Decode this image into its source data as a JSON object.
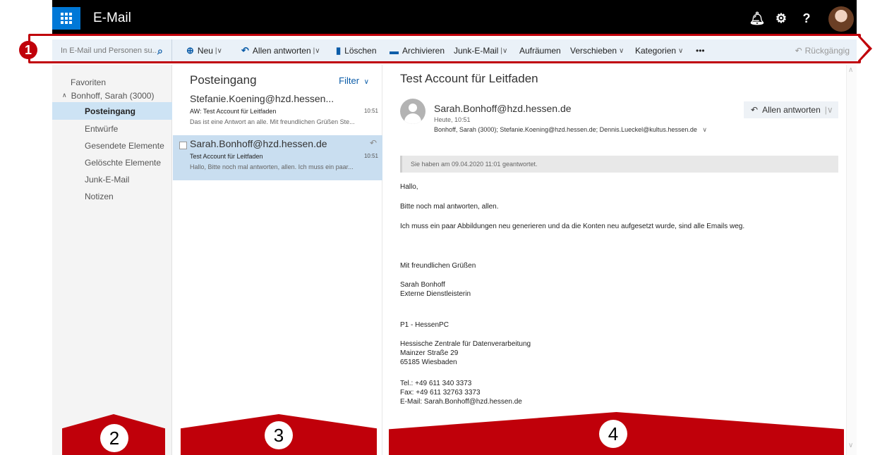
{
  "header": {
    "app_title": "E-Mail",
    "icons": [
      "waffle-icon",
      "bell-icon",
      "gear-icon",
      "help-icon",
      "avatar"
    ]
  },
  "toolbar": {
    "search_placeholder": "In E-Mail und Personen su...",
    "new_label": "Neu",
    "reply_all_label": "Allen antworten",
    "delete_label": "Löschen",
    "archive_label": "Archivieren",
    "junk_label": "Junk-E-Mail",
    "sweep_label": "Aufräumen",
    "move_label": "Verschieben",
    "categories_label": "Kategorien",
    "more_label": "•••",
    "undo_label": "Rückgängig"
  },
  "folders": {
    "favorites": "Favoriten",
    "account": "Bonhoff, Sarah (3000)",
    "items": [
      {
        "label": "Posteingang",
        "selected": true
      },
      {
        "label": "Entwürfe"
      },
      {
        "label": "Gesendete Elemente"
      },
      {
        "label": "Gelöschte Elemente"
      },
      {
        "label": "Junk-E-Mail"
      },
      {
        "label": "Notizen"
      }
    ]
  },
  "message_list": {
    "title": "Posteingang",
    "filter_label": "Filter",
    "messages": [
      {
        "sender": "Stefanie.Koening@hzd.hessen...",
        "subject": "AW: Test Account für Leitfaden",
        "time": "10:51",
        "preview": "Das ist eine Antwort an alle. Mit freundlichen Grüßen Ste..."
      },
      {
        "sender": "Sarah.Bonhoff@hzd.hessen.de",
        "subject": "Test Account für Leitfaden",
        "time": "10:51",
        "preview": "Hallo, Bitte noch mal antworten, allen. Ich muss ein paar...",
        "selected": true
      }
    ]
  },
  "reading_pane": {
    "subject": "Test Account für Leitfaden",
    "from": "Sarah.Bonhoff@hzd.hessen.de",
    "date": "Heute, 10:51",
    "to": "Bonhoff, Sarah (3000); Stefanie.Koening@hzd.hessen.de; Dennis.Lueckel@kultus.hessen.de",
    "reply_all_label": "Allen antworten",
    "notice": "Sie haben am 09.04.2020 11:01 geantwortet.",
    "body": {
      "greeting": "Hallo,",
      "line1": "Bitte noch mal antworten, allen.",
      "line2": "Ich muss ein paar Abbildungen neu generieren und da die Konten neu aufgesetzt wurde, sind alle Emails weg.",
      "closing": "Mit freundlichen Grüßen",
      "sig_name": "Sarah Bonhoff",
      "sig_role": "Externe Dienstleisterin",
      "sig_dept": "P1 - HessenPC",
      "sig_org": "Hessische Zentrale für Datenverarbeitung",
      "sig_street": "Mainzer Straße 29",
      "sig_city": "65185 Wiesbaden",
      "sig_tel": "Tel.:  +49 611 340 3373",
      "sig_fax": "Fax:   +49 611 32763 3373",
      "sig_email": "E-Mail: Sarah.Bonhoff@hzd.hessen.de"
    }
  },
  "annotations": {
    "badge1": "1",
    "badge2": "2",
    "badge3": "3",
    "badge4": "4",
    "color": "#c0000a"
  }
}
